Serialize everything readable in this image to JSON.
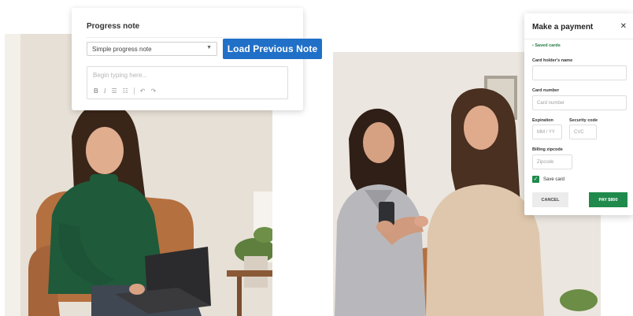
{
  "progress_note": {
    "title": "Progress note",
    "template_select_value": "Simple progress note",
    "editor_placeholder": "Begin typing here...",
    "toolbar_icons": [
      "bold-icon",
      "italic-icon",
      "bullet-list-icon",
      "numbered-list-icon",
      "undo-icon",
      "redo-icon"
    ],
    "load_button_label": "Load Previous Note",
    "load_button_color": "#2170c8"
  },
  "payment": {
    "title": "Make a payment",
    "close_glyph": "✕",
    "saved_cards_link": "Saved cards",
    "card_holder_label": "Card holder's name",
    "card_holder_value": "",
    "card_number_label": "Card number",
    "card_number_placeholder": "Card number",
    "expiration_label": "Expiration",
    "expiration_placeholder": "MM / YY",
    "security_label": "Security code",
    "security_placeholder": "CVC",
    "zip_label": "Billing zipcode",
    "zip_placeholder": "Zipcode",
    "save_card_label": "Save card",
    "save_card_checked": true,
    "cancel_label": "CANCEL",
    "pay_label": "PAY $800",
    "accent_color": "#1f8a4c"
  }
}
